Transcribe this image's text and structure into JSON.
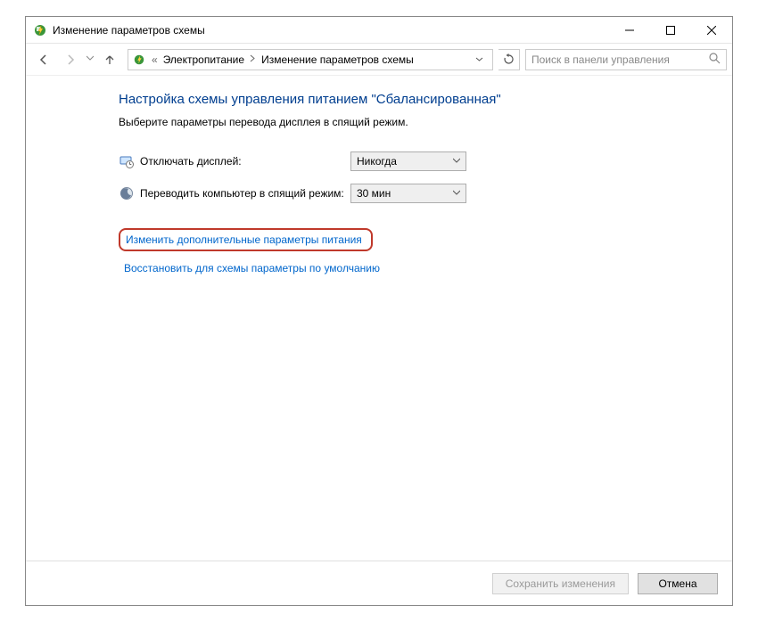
{
  "window": {
    "title": "Изменение параметров схемы"
  },
  "breadcrumb": {
    "item1": "Электропитание",
    "item2": "Изменение параметров схемы"
  },
  "search": {
    "placeholder": "Поиск в панели управления"
  },
  "page": {
    "heading": "Настройка схемы управления питанием \"Сбалансированная\"",
    "subtext": "Выберите параметры перевода дисплея в спящий режим."
  },
  "settings": {
    "display_off": {
      "label": "Отключать дисплей:",
      "value": "Никогда"
    },
    "sleep": {
      "label": "Переводить компьютер в спящий режим:",
      "value": "30 мин"
    }
  },
  "links": {
    "advanced": "Изменить дополнительные параметры питания",
    "restore": "Восстановить для схемы параметры по умолчанию"
  },
  "footer": {
    "save": "Сохранить изменения",
    "cancel": "Отмена"
  }
}
